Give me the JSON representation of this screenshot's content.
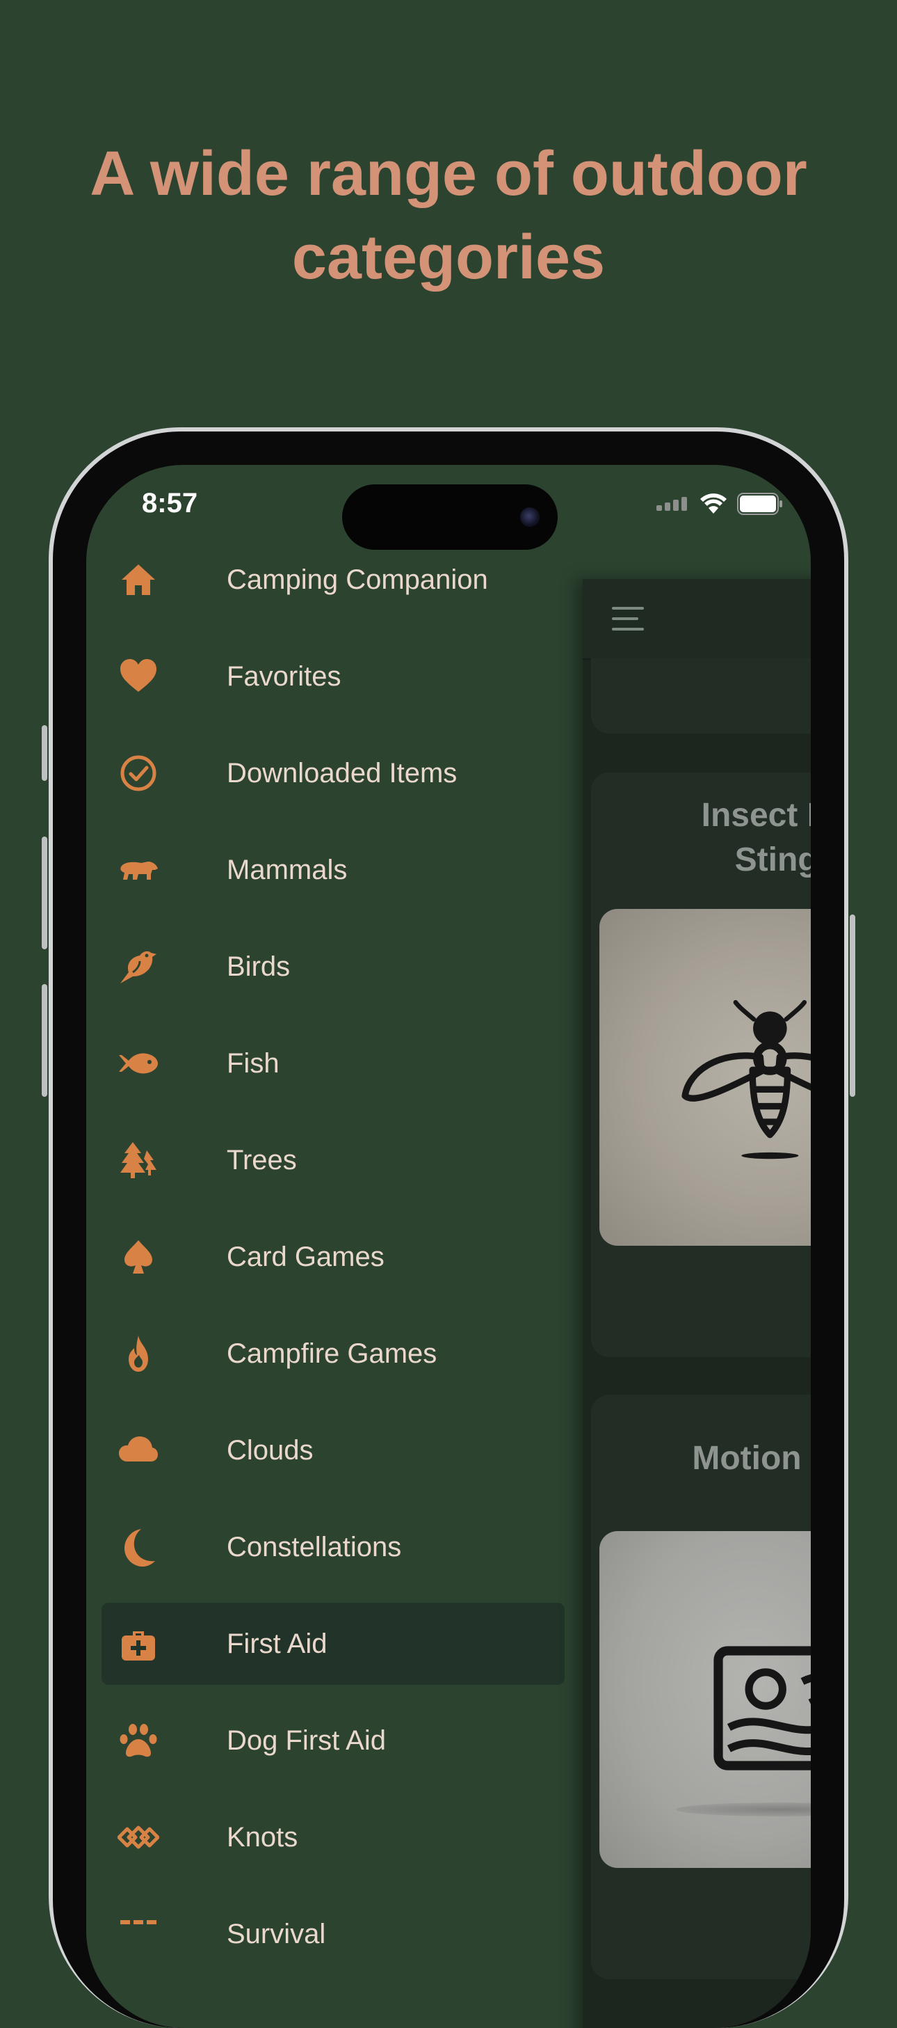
{
  "headline": {
    "line1": "A wide range of outdoor",
    "line2": "categories"
  },
  "status_bar": {
    "time": "8:57",
    "icons": [
      "cellular-signal-icon",
      "wifi-icon",
      "battery-icon"
    ]
  },
  "menu": {
    "items": [
      {
        "label": "Camping Companion",
        "icon": "home-icon"
      },
      {
        "label": "Favorites",
        "icon": "heart-icon"
      },
      {
        "label": "Downloaded Items",
        "icon": "check-circle-icon"
      },
      {
        "label": "Mammals",
        "icon": "bear-icon"
      },
      {
        "label": "Birds",
        "icon": "bird-icon"
      },
      {
        "label": "Fish",
        "icon": "fish-icon"
      },
      {
        "label": "Trees",
        "icon": "trees-icon"
      },
      {
        "label": "Card Games",
        "icon": "spade-icon"
      },
      {
        "label": "Campfire Games",
        "icon": "fire-icon"
      },
      {
        "label": "Clouds",
        "icon": "cloud-icon"
      },
      {
        "label": "Constellations",
        "icon": "moon-icon"
      },
      {
        "label": "First Aid",
        "icon": "first-aid-kit-icon",
        "selected": true
      },
      {
        "label": "Dog First Aid",
        "icon": "paw-icon"
      },
      {
        "label": "Knots",
        "icon": "knot-icon"
      },
      {
        "label": "Survival",
        "icon": "survival-icon"
      }
    ]
  },
  "content": {
    "menu_button_icon": "hamburger-menu-icon",
    "cards": [
      {
        "title_line1": "Insect Bite",
        "title_line2": "Stings",
        "image_icon": "bee-icon"
      },
      {
        "title_line1": "Motion Sick",
        "title_line2": "",
        "image_icon": "motion-sickness-icon"
      }
    ]
  },
  "colors": {
    "background": "#2c4330",
    "accent": "#d98245",
    "headline": "#d49377",
    "menu_text": "#ead8cc",
    "selected_row": "#22332a",
    "content_panel": "#1c261f"
  }
}
